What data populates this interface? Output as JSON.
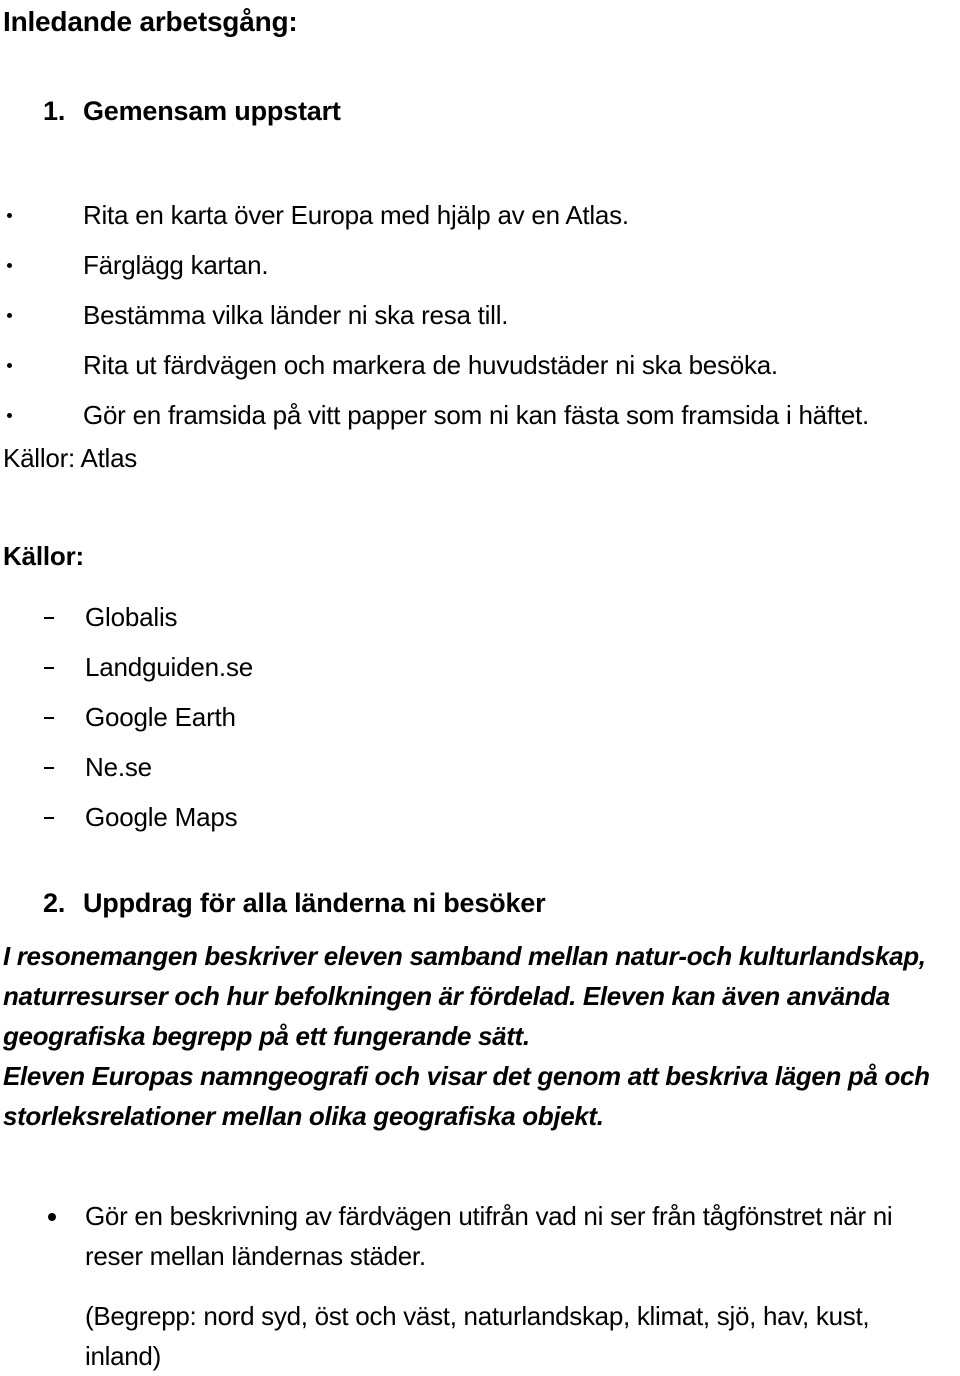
{
  "document": {
    "title": "Inledande arbetsgång:",
    "background_color": "#ffffff",
    "text_color": "#000000"
  },
  "section1": {
    "number": "1.",
    "heading": "Gemensam uppstart",
    "bullets": [
      "Rita en karta över Europa med hjälp av en Atlas.",
      "Färglägg kartan.",
      "Bestämma vilka länder ni ska resa till.",
      "Rita ut färdvägen och markera de huvudstäder ni ska besöka.",
      "Gör en framsida på vitt papper som ni kan fästa som framsida i häftet."
    ],
    "sources_inline": "Källor: Atlas"
  },
  "sources": {
    "heading": "Källor:",
    "items": [
      "Globalis",
      "Landguiden.se",
      "Google Earth",
      "Ne.se",
      "Google Maps"
    ]
  },
  "section2": {
    "number": "2.",
    "heading": "Uppdrag för alla länderna ni besöker",
    "paragraph1_lines": [
      "I resonemangen beskriver eleven samband mellan natur-och kulturlandskap,",
      "naturresurser och hur befolkningen är fördelad. Eleven kan även använda",
      "geografiska begrepp på ett fungerande sätt."
    ],
    "paragraph2_lines": [
      "Eleven Europas namngeografi och visar det genom att beskriva lägen på och",
      "storleksrelationer mellan olika geografiska objekt."
    ],
    "final_bullet_lines": [
      "Gör en beskrivning av färdvägen utifrån vad ni ser från tågfönstret när ni",
      "reser mellan ländernas städer."
    ],
    "final_note_lines": [
      "(Begrepp: nord syd, öst och väst, naturlandskap, klimat, sjö, hav, kust,",
      "inland)"
    ]
  }
}
